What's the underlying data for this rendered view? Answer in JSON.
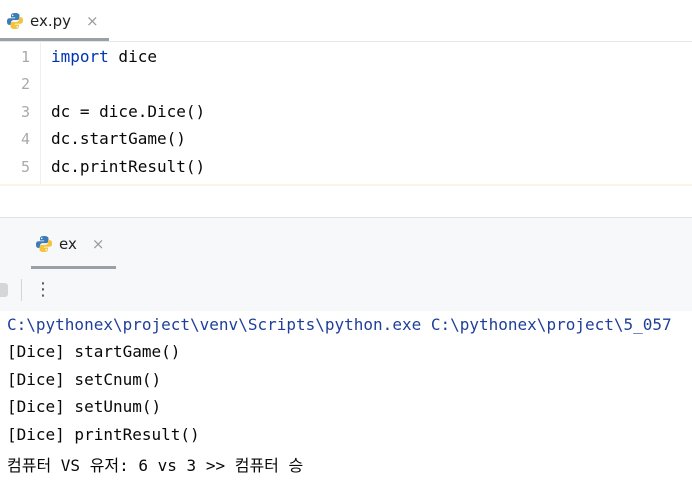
{
  "editor_tab": {
    "file_name": "ex.py",
    "close": "×"
  },
  "editor": {
    "line_numbers": [
      "1",
      "2",
      "3",
      "4",
      "5"
    ],
    "lines": {
      "l1_keyword": "import",
      "l1_rest": " dice",
      "l2": "",
      "l3": "dc = dice.Dice()",
      "l4": "dc.startGame()",
      "l5": "dc.printResult()"
    }
  },
  "run_panel": {
    "tab_label": "ex",
    "close": "×",
    "more_icon": "⋮",
    "console": [
      "C:\\pythonex\\project\\venv\\Scripts\\python.exe C:\\pythonex\\project\\5_057",
      "[Dice] startGame()",
      "[Dice] setCnum()",
      "[Dice] setUnum()",
      "[Dice] printResult()",
      "컴퓨터 VS 유저: 6 vs 3 >> 컴퓨터 승"
    ]
  },
  "colors": {
    "keyword": "#0033b3",
    "command_path": "#1f3f9a",
    "python_blue": "#3d7ab8",
    "python_yellow": "#f3c33c"
  }
}
